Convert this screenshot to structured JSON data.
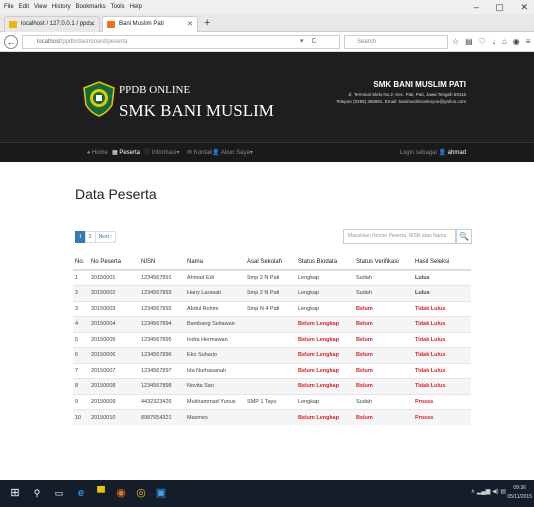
{
  "menubar": {
    "items": [
      "File",
      "Edit",
      "View",
      "History",
      "Bookmarks",
      "Tools",
      "Help"
    ],
    "underline": [
      "F",
      "E",
      "V",
      "s",
      "B",
      "T",
      "H"
    ]
  },
  "window": {
    "minimize": "–",
    "maximize": "▢",
    "close": "✕"
  },
  "tabs": [
    {
      "label": "localhost / 127.0.0.1 / ppd...",
      "active": false
    },
    {
      "label": "Bani Muslim Pati",
      "active": true
    }
  ],
  "browser": {
    "url_host": "localhost",
    "url_path": "/ppdb/dashboard/peserta",
    "search_placeholder": "Search",
    "reload": "C"
  },
  "header": {
    "brand_line1": "PPDB ONLINE",
    "brand_line2": "SMK BANI MUSLIM",
    "school_name": "SMK BANI MUSLIM PATI",
    "school_address": "Jl. Terminal Slelo No.2, Kec. Pati, Pati, Jawa Tengah 59116",
    "school_contact": "Telepon (0295) 385981. Email: banimuslimsmknyun@yahoo.com"
  },
  "nav": {
    "home": "Home",
    "peserta": "Peserta",
    "informasi": "Informasi",
    "kontak": "Kontak",
    "akun": "Akun Saya",
    "login_info": "Login sebagai",
    "user": "ahmad"
  },
  "page": {
    "title": "Data Peserta"
  },
  "pagination": {
    "pages": [
      "1",
      "2"
    ],
    "next": "Next ›"
  },
  "filter": {
    "placeholder": "Masukkan Nomor Peserta, NISN atau Nama"
  },
  "table": {
    "headers": [
      "No.",
      "No Peserta",
      "NISN",
      "Nama",
      "Asal Sekolah",
      "Status Biodata",
      "Status Verifikasi",
      "Hasil Seleksi"
    ],
    "rows": [
      [
        "1",
        "20150001",
        "1234567891",
        "Ahmad Edi",
        "Smp 2 N Pati",
        "Lengkap",
        "Sudah",
        "Lulus"
      ],
      [
        "2",
        "20150002",
        "1234567893",
        "Hany Larasati",
        "Smp 2 N Pati",
        "Lengkap",
        "Sudah",
        "Lulus"
      ],
      [
        "3",
        "20150003",
        "1234567892",
        "Abdul Rohim",
        "Smp N 4 Pati",
        "Lengkap",
        "Belum",
        "Tidak Lulus"
      ],
      [
        "4",
        "20150004",
        "1234567894",
        "Bambang Setiawan",
        "",
        "Belum Lengkap",
        "Belum",
        "Tidak Lulus"
      ],
      [
        "5",
        "20150005",
        "1234567895",
        "Indra Hermawan",
        "",
        "Belum Lengkap",
        "Belum",
        "Tidak Lulus"
      ],
      [
        "6",
        "20150006",
        "1234567896",
        "Eko Suharjo",
        "",
        "Belum Lengkap",
        "Belum",
        "Tidak Lulus"
      ],
      [
        "7",
        "20150007",
        "1234567897",
        "Ida Nurhasanah",
        "",
        "Belum Lengkap",
        "Belum",
        "Tidak Lulus"
      ],
      [
        "8",
        "20150008",
        "1234567898",
        "Novita Sari",
        "",
        "Belum Lengkap",
        "Belum",
        "Tidak Lulus"
      ],
      [
        "9",
        "20150009",
        "4432323426",
        "Mukhammad Yunus",
        "SMP 1 Tayu",
        "Lengkap",
        "Sudah",
        "Proses"
      ],
      [
        "10",
        "20150010",
        "8987654321",
        "Masmes",
        "",
        "Belum Lengkap",
        "Belum",
        "Proses"
      ]
    ]
  },
  "taskbar": {
    "time": "09:36",
    "date": "05/11/2015"
  },
  "colors": {
    "accent": "#337ab7",
    "danger": "#e02020",
    "header_bg": "#1e1e1e"
  }
}
